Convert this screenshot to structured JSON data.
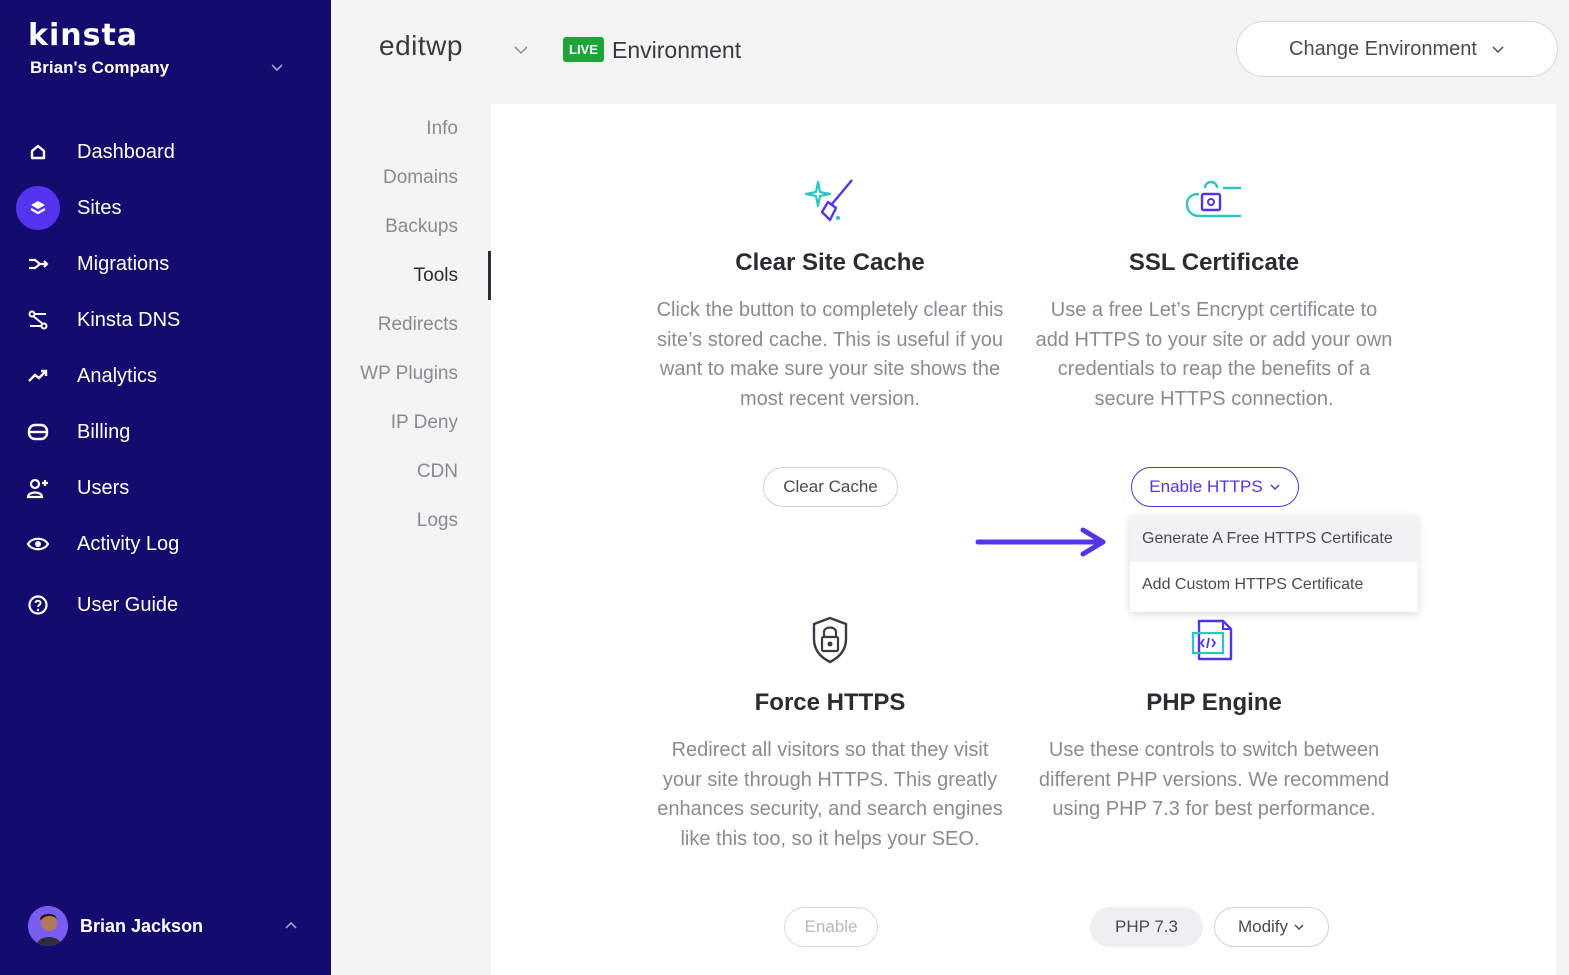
{
  "brand": {
    "logo": "kinsta",
    "company": "Brian's Company"
  },
  "sidebar": {
    "items": [
      {
        "label": "Dashboard",
        "icon": "home-icon"
      },
      {
        "label": "Sites",
        "icon": "layers-icon",
        "active": true
      },
      {
        "label": "Migrations",
        "icon": "migration-icon"
      },
      {
        "label": "Kinsta DNS",
        "icon": "dns-icon"
      },
      {
        "label": "Analytics",
        "icon": "trend-icon"
      },
      {
        "label": "Billing",
        "icon": "card-icon"
      },
      {
        "label": "Users",
        "icon": "add-user-icon"
      },
      {
        "label": "Activity Log",
        "icon": "eye-icon"
      },
      {
        "label": "User Guide",
        "icon": "help-icon"
      }
    ],
    "user": {
      "name": "Brian Jackson"
    }
  },
  "header": {
    "site_name": "editwp",
    "live_badge": "LIVE",
    "environment_label": "Environment",
    "change_environment": "Change Environment"
  },
  "subnav": {
    "items": [
      "Info",
      "Domains",
      "Backups",
      "Tools",
      "Redirects",
      "WP Plugins",
      "IP Deny",
      "CDN",
      "Logs"
    ],
    "active": "Tools"
  },
  "tools": {
    "clear_cache": {
      "title": "Clear Site Cache",
      "description": "Click the button to completely clear this site’s stored cache. This is useful if you want to make sure your site shows the most recent version.",
      "button": "Clear Cache"
    },
    "ssl": {
      "title": "SSL Certificate",
      "description": "Use a free Let’s Encrypt certificate to add HTTPS to your site or add your own credentials to reap the benefits of a secure HTTPS connection.",
      "button": "Enable HTTPS",
      "menu": [
        "Generate A Free HTTPS Certificate",
        "Add Custom HTTPS Certificate"
      ]
    },
    "force_https": {
      "title": "Force HTTPS",
      "description": "Redirect all visitors so that they visit your site through HTTPS. This greatly enhances security, and search engines like this too, so it helps your SEO.",
      "button": "Enable"
    },
    "php": {
      "title": "PHP Engine",
      "description": "Use these controls to switch between different PHP versions. We recommend using PHP 7.3 for best performance.",
      "version": "PHP 7.3",
      "button": "Modify"
    }
  },
  "colors": {
    "sidebar_bg": "#140b6e",
    "accent": "#5333ed",
    "live": "#1fa43a",
    "teal": "#2ec4c4"
  }
}
